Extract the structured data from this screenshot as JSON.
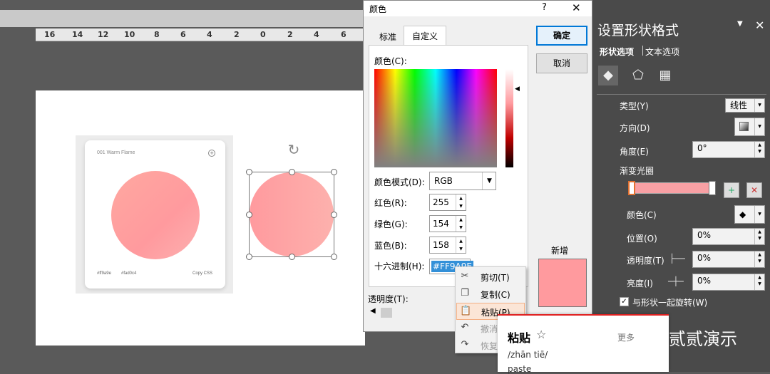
{
  "ruler": {
    "ticks": [
      "16",
      "14",
      "12",
      "10",
      "8",
      "6",
      "4",
      "2",
      "0",
      "2",
      "4",
      "6"
    ]
  },
  "card": {
    "title": "001 Warm Flame",
    "code1": "#ff9a9e",
    "code2": "#fad0c4",
    "copy_label": "Copy CSS"
  },
  "colors": {
    "accent": "#0078d7",
    "fill_pink": "#ff9a9e",
    "pane_bg": "#4a4a4a",
    "highlight": "#3390d8"
  },
  "dialog": {
    "title": "颜色",
    "help": "?",
    "close": "✕",
    "tab_standard": "标准",
    "tab_custom": "自定义",
    "color_label": "颜色(C):",
    "mode_label": "颜色模式(D):",
    "mode_value": "RGB",
    "red_label": "红色(R):",
    "red_value": "255",
    "green_label": "绿色(G):",
    "green_value": "154",
    "blue_label": "蓝色(B):",
    "blue_value": "158",
    "hex_label": "十六进制(H):",
    "hex_value": "#FF9A9E",
    "ok": "确定",
    "cancel": "取消",
    "new_label": "新增",
    "transparency_label": "透明度(T):"
  },
  "context_menu": {
    "items": [
      {
        "label": "剪切(T)",
        "icon": "scissors-icon"
      },
      {
        "label": "复制(C)",
        "icon": "copy-icon"
      },
      {
        "label": "粘贴(P)",
        "icon": "paste-icon"
      },
      {
        "label": "撤消",
        "icon": "undo-icon"
      },
      {
        "label": "恢复",
        "icon": "redo-icon"
      }
    ]
  },
  "dictionary": {
    "word": "粘贴",
    "more": "更多",
    "pinyin": "/zhān tiē/",
    "definition": "paste"
  },
  "pane": {
    "title": "设置形状格式",
    "tab_shape": "形状选项",
    "tab_text": "文本选项",
    "type_label": "类型(Y)",
    "type_value": "线性",
    "direction_label": "方向(D)",
    "angle_label": "角度(E)",
    "angle_value": "0°",
    "gradient_stops_label": "渐变光圈",
    "color_label": "颜色(C)",
    "position_label": "位置(O)",
    "position_value": "0%",
    "transparency_label": "透明度(T)",
    "transparency_value": "0%",
    "brightness_label": "亮度(I)",
    "brightness_value": "0%",
    "rotate_label": "与形状一起旋转(W)"
  },
  "watermark": {
    "text": "贰贰演示"
  }
}
